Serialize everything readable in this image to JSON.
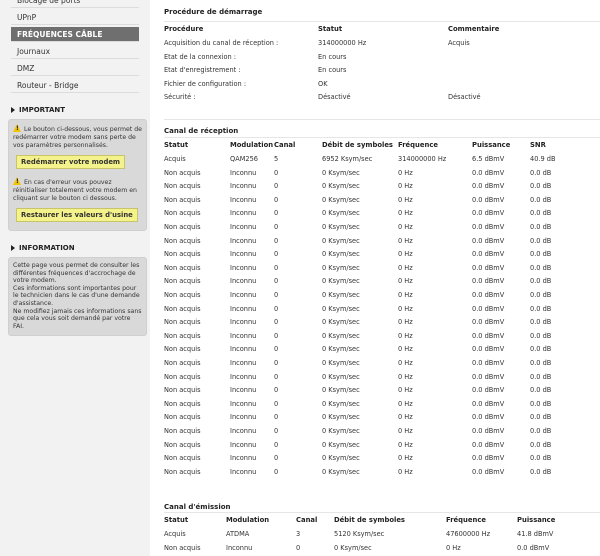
{
  "sidebar": {
    "nav": [
      {
        "label": "Blocage de ports",
        "active": false
      },
      {
        "label": "UPnP",
        "active": false
      },
      {
        "label": "FRÉQUENCES CÂBLE",
        "active": true
      },
      {
        "label": "Journaux",
        "active": false
      },
      {
        "label": "DMZ",
        "active": false
      },
      {
        "label": "Routeur - Bridge",
        "active": false
      }
    ],
    "important": {
      "title": "IMPORTANT",
      "restart_text": "Le bouton ci-dessous, vous permet de redémarrer votre modem sans perte de vos paramètres personnalisés.",
      "restart_button": "Redémarrer votre modem",
      "reset_text": "En cas d'erreur vous pouvez réinitialiser totalement votre modem en cliquant sur le bouton ci dessous.",
      "reset_button": "Restaurer les valeurs d'usine"
    },
    "information": {
      "title": "INFORMATION",
      "text": "Cette page vous permet de consulter les différentes fréquences d'accrochage de votre modem.\nCes informations sont importantes pour le technicien dans le cas d'une demande d'assistance.\nNe modifiez jamais ces informations sans que cela vous soit demandé par votre FAI."
    }
  },
  "startup": {
    "title": "Procédure de démarrage",
    "headers": [
      "Procédure",
      "Statut",
      "Commentaire"
    ],
    "rows": [
      [
        "Acquisition du canal de réception :",
        "314000000 Hz",
        "Acquis"
      ],
      [
        "Etat de la connexion :",
        "En cours",
        ""
      ],
      [
        "Etat d'enregistrement :",
        "En cours",
        ""
      ],
      [
        "Fichier de configuration :",
        "OK",
        ""
      ],
      [
        "Sécurité :",
        "Désactivé",
        "Désactivé"
      ]
    ]
  },
  "downstream": {
    "title": "Canal de réception",
    "headers": [
      "Statut",
      "Modulation",
      "Canal",
      "Débit de symboles",
      "Fréquence",
      "Puissance",
      "SNR"
    ],
    "rows": [
      [
        "Acquis",
        "QAM256",
        "5",
        "6952 Ksym/sec",
        "314000000 Hz",
        "6.5 dBmV",
        "40.9 dB"
      ],
      [
        "Non acquis",
        "Inconnu",
        "0",
        "0 Ksym/sec",
        "0 Hz",
        "0.0 dBmV",
        "0.0 dB"
      ],
      [
        "Non acquis",
        "Inconnu",
        "0",
        "0 Ksym/sec",
        "0 Hz",
        "0.0 dBmV",
        "0.0 dB"
      ],
      [
        "Non acquis",
        "Inconnu",
        "0",
        "0 Ksym/sec",
        "0 Hz",
        "0.0 dBmV",
        "0.0 dB"
      ],
      [
        "Non acquis",
        "Inconnu",
        "0",
        "0 Ksym/sec",
        "0 Hz",
        "0.0 dBmV",
        "0.0 dB"
      ],
      [
        "Non acquis",
        "Inconnu",
        "0",
        "0 Ksym/sec",
        "0 Hz",
        "0.0 dBmV",
        "0.0 dB"
      ],
      [
        "Non acquis",
        "Inconnu",
        "0",
        "0 Ksym/sec",
        "0 Hz",
        "0.0 dBmV",
        "0.0 dB"
      ],
      [
        "Non acquis",
        "Inconnu",
        "0",
        "0 Ksym/sec",
        "0 Hz",
        "0.0 dBmV",
        "0.0 dB"
      ],
      [
        "Non acquis",
        "Inconnu",
        "0",
        "0 Ksym/sec",
        "0 Hz",
        "0.0 dBmV",
        "0.0 dB"
      ],
      [
        "Non acquis",
        "Inconnu",
        "0",
        "0 Ksym/sec",
        "0 Hz",
        "0.0 dBmV",
        "0.0 dB"
      ],
      [
        "Non acquis",
        "Inconnu",
        "0",
        "0 Ksym/sec",
        "0 Hz",
        "0.0 dBmV",
        "0.0 dB"
      ],
      [
        "Non acquis",
        "Inconnu",
        "0",
        "0 Ksym/sec",
        "0 Hz",
        "0.0 dBmV",
        "0.0 dB"
      ],
      [
        "Non acquis",
        "Inconnu",
        "0",
        "0 Ksym/sec",
        "0 Hz",
        "0.0 dBmV",
        "0.0 dB"
      ],
      [
        "Non acquis",
        "Inconnu",
        "0",
        "0 Ksym/sec",
        "0 Hz",
        "0.0 dBmV",
        "0.0 dB"
      ],
      [
        "Non acquis",
        "Inconnu",
        "0",
        "0 Ksym/sec",
        "0 Hz",
        "0.0 dBmV",
        "0.0 dB"
      ],
      [
        "Non acquis",
        "Inconnu",
        "0",
        "0 Ksym/sec",
        "0 Hz",
        "0.0 dBmV",
        "0.0 dB"
      ],
      [
        "Non acquis",
        "Inconnu",
        "0",
        "0 Ksym/sec",
        "0 Hz",
        "0.0 dBmV",
        "0.0 dB"
      ],
      [
        "Non acquis",
        "Inconnu",
        "0",
        "0 Ksym/sec",
        "0 Hz",
        "0.0 dBmV",
        "0.0 dB"
      ],
      [
        "Non acquis",
        "Inconnu",
        "0",
        "0 Ksym/sec",
        "0 Hz",
        "0.0 dBmV",
        "0.0 dB"
      ],
      [
        "Non acquis",
        "Inconnu",
        "0",
        "0 Ksym/sec",
        "0 Hz",
        "0.0 dBmV",
        "0.0 dB"
      ],
      [
        "Non acquis",
        "Inconnu",
        "0",
        "0 Ksym/sec",
        "0 Hz",
        "0.0 dBmV",
        "0.0 dB"
      ],
      [
        "Non acquis",
        "Inconnu",
        "0",
        "0 Ksym/sec",
        "0 Hz",
        "0.0 dBmV",
        "0.0 dB"
      ],
      [
        "Non acquis",
        "Inconnu",
        "0",
        "0 Ksym/sec",
        "0 Hz",
        "0.0 dBmV",
        "0.0 dB"
      ],
      [
        "Non acquis",
        "Inconnu",
        "0",
        "0 Ksym/sec",
        "0 Hz",
        "0.0 dBmV",
        "0.0 dB"
      ]
    ]
  },
  "upstream": {
    "title": "Canal d'émission",
    "headers": [
      "Statut",
      "Modulation",
      "Canal",
      "Débit de symboles",
      "Fréquence",
      "Puissance"
    ],
    "rows": [
      [
        "Acquis",
        "ATDMA",
        "3",
        "5120 Ksym/sec",
        "47600000 Hz",
        "41.8 dBmV"
      ],
      [
        "Non acquis",
        "Inconnu",
        "0",
        "0 Ksym/sec",
        "0 Hz",
        "0.0 dBmV"
      ]
    ]
  }
}
